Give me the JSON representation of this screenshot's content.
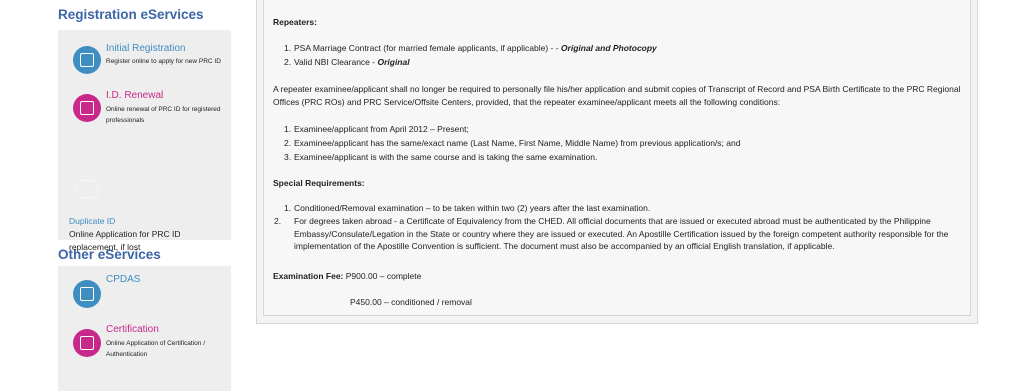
{
  "sidebar": {
    "registration_title": "Registration eServices",
    "initial": {
      "title": "Initial Registration",
      "desc": "Register online to apply for new PRC ID"
    },
    "idrenewal": {
      "title": "I.D. Renewal",
      "desc": "Online renewal of PRC ID for registered professionals"
    },
    "duplicate": {
      "title": "Duplicate ID",
      "desc": "Online Application for PRC ID replacement, if lost"
    },
    "other_title": "Other eServices",
    "cpdas": {
      "title": "CPDAS"
    },
    "certification": {
      "title": "Certification",
      "desc": "Online Application of Certification / Authentication"
    }
  },
  "content": {
    "repeaters_heading": "Repeaters:",
    "rep_items": [
      {
        "num": "1.",
        "text": "PSA Marriage Contract (for married female applicants, if applicable) - - ",
        "em": "Original and Photocopy"
      },
      {
        "num": "2.",
        "text": "Valid NBI Clearance - ",
        "em": "Original"
      }
    ],
    "para": "A repeater examinee/applicant shall no longer be required to personally file his/her application and submit copies of Transcript of Record and PSA Birth Certificate to the PRC Regional Offices (PRC ROs) and PRC Service/Offsite Centers, provided, that the repeater examinee/applicant meets all the following conditions:",
    "cond_items": [
      {
        "num": "1.",
        "text": "Examinee/applicant from April 2012 – Present;"
      },
      {
        "num": "2.",
        "text": "Examinee/applicant has the same/exact name (Last Name, First Name, Middle Name) from previous application/s; and"
      },
      {
        "num": "3.",
        "text": "Examinee/applicant is with the same course and is taking the same examination."
      }
    ],
    "special_heading": "Special Requirements:",
    "spec_items": [
      {
        "num": "1.",
        "text": "Conditioned/Removal examination – to be taken within two (2) years after the last examination."
      },
      {
        "num": "2.",
        "text": "For degrees taken abroad - a Certificate of Equivalency from the CHED. All official documents that are issued or executed abroad must be authenticated by the Philippine Embassy/Consulate/Legation in the State or country where they are issued or executed. An Apostille Certification issued by the foreign competent authority responsible for the implementation of the Apostille Convention is sufficient. The document must also be accompanied by an official English translation, if applicable."
      }
    ],
    "fee_label": "Examination Fee:",
    "fee1": " P900.00 – complete",
    "fee2": "P450.00 – conditioned / removal"
  }
}
